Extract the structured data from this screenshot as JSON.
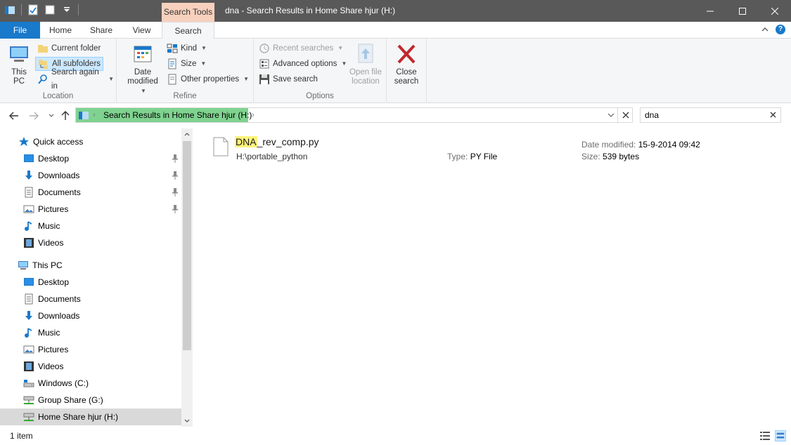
{
  "window": {
    "title": "dna - Search Results in Home Share hjur (H:)",
    "context_tab": "Search Tools",
    "controls": {
      "minimize": "—",
      "maximize": "☐",
      "close": "✕"
    }
  },
  "ribbon_tabs": {
    "file": "File",
    "home": "Home",
    "share": "Share",
    "view": "View",
    "search": "Search",
    "help": "?"
  },
  "ribbon": {
    "location": {
      "label": "Location",
      "this_pc": "This PC",
      "current_folder": "Current folder",
      "all_subfolders": "All subfolders",
      "search_again_in": "Search again in"
    },
    "refine": {
      "label": "Refine",
      "date_modified": "Date modified",
      "kind": "Kind",
      "size": "Size",
      "other_properties": "Other properties"
    },
    "options": {
      "label": "Options",
      "recent_searches": "Recent searches",
      "advanced_options": "Advanced options",
      "save_search": "Save search",
      "open_file_location": "Open file location"
    },
    "close": {
      "close_search": "Close search"
    }
  },
  "address": {
    "path": "Search Results in Home Share hjur (H:)",
    "search_value": "dna"
  },
  "nav": {
    "quick_access": {
      "label": "Quick access",
      "items": [
        {
          "label": "Desktop",
          "pinned": true
        },
        {
          "label": "Downloads",
          "pinned": true
        },
        {
          "label": "Documents",
          "pinned": true
        },
        {
          "label": "Pictures",
          "pinned": true
        },
        {
          "label": "Music",
          "pinned": false
        },
        {
          "label": "Videos",
          "pinned": false
        }
      ]
    },
    "this_pc": {
      "label": "This PC",
      "items": [
        {
          "label": "Desktop"
        },
        {
          "label": "Documents"
        },
        {
          "label": "Downloads"
        },
        {
          "label": "Music"
        },
        {
          "label": "Pictures"
        },
        {
          "label": "Videos"
        },
        {
          "label": "Windows (C:)"
        },
        {
          "label": "Group Share (G:)"
        },
        {
          "label": "Home Share hjur (H:)",
          "selected": true
        }
      ]
    }
  },
  "results": [
    {
      "name_highlight": "DNA",
      "name_rest": "_rev_comp.py",
      "path": "H:\\portable_python",
      "type_label": "Type:",
      "type_value": "PY File",
      "date_label": "Date modified:",
      "date_value": "15-9-2014 09:42",
      "size_label": "Size:",
      "size_value": "539 bytes"
    }
  ],
  "status": {
    "count": "1 item"
  },
  "colors": {
    "file_tab": "#1979ca",
    "search_tools": "#f7d1bd",
    "address_progress": "#7fd38f",
    "selected": "#cce8ff",
    "match_highlight": "#fff37b"
  }
}
